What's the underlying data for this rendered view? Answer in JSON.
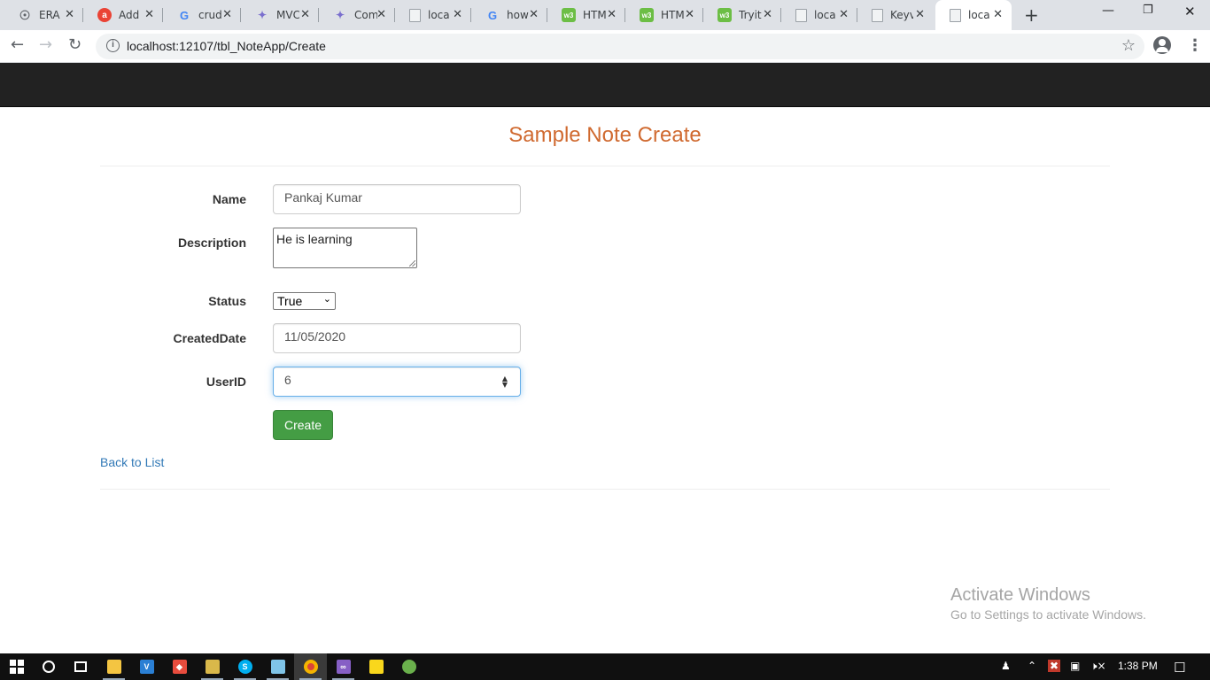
{
  "browser": {
    "tabs": [
      {
        "title": "ERA",
        "icon": "globe-icon"
      },
      {
        "title": "Add",
        "icon": "red-circle-icon"
      },
      {
        "title": "crud",
        "icon": "google-icon"
      },
      {
        "title": "MVC",
        "icon": "mvc-icon"
      },
      {
        "title": "Com",
        "icon": "mvc-icon"
      },
      {
        "title": "loca",
        "icon": "page-icon"
      },
      {
        "title": "how",
        "icon": "google-icon"
      },
      {
        "title": "HTM",
        "icon": "w3schools-icon"
      },
      {
        "title": "HTM",
        "icon": "w3schools-icon"
      },
      {
        "title": "Tryit",
        "icon": "w3schools-icon"
      },
      {
        "title": "loca",
        "icon": "page-icon"
      },
      {
        "title": "Keyv",
        "icon": "page-icon"
      },
      {
        "title": "loca",
        "icon": "page-icon",
        "active": true
      }
    ],
    "url": "localhost:12107/tbl_NoteApp/Create"
  },
  "page": {
    "title": "Sample Note Create",
    "form": {
      "name_label": "Name",
      "name_value": "Pankaj Kumar",
      "description_label": "Description",
      "description_value": "He is learning",
      "status_label": "Status",
      "status_value": "True",
      "createddate_label": "CreatedDate",
      "createddate_value": "11/05/2020",
      "userid_label": "UserID",
      "userid_value": "6",
      "create_button": "Create"
    },
    "back_link": "Back to List"
  },
  "watermark": {
    "line1": "Activate Windows",
    "line2": "Go to Settings to activate Windows."
  },
  "taskbar": {
    "clock": "1:38 PM"
  },
  "colors": {
    "title": "#d06a30",
    "navbar": "#222222",
    "button": "#449d44",
    "link": "#337ab7"
  }
}
